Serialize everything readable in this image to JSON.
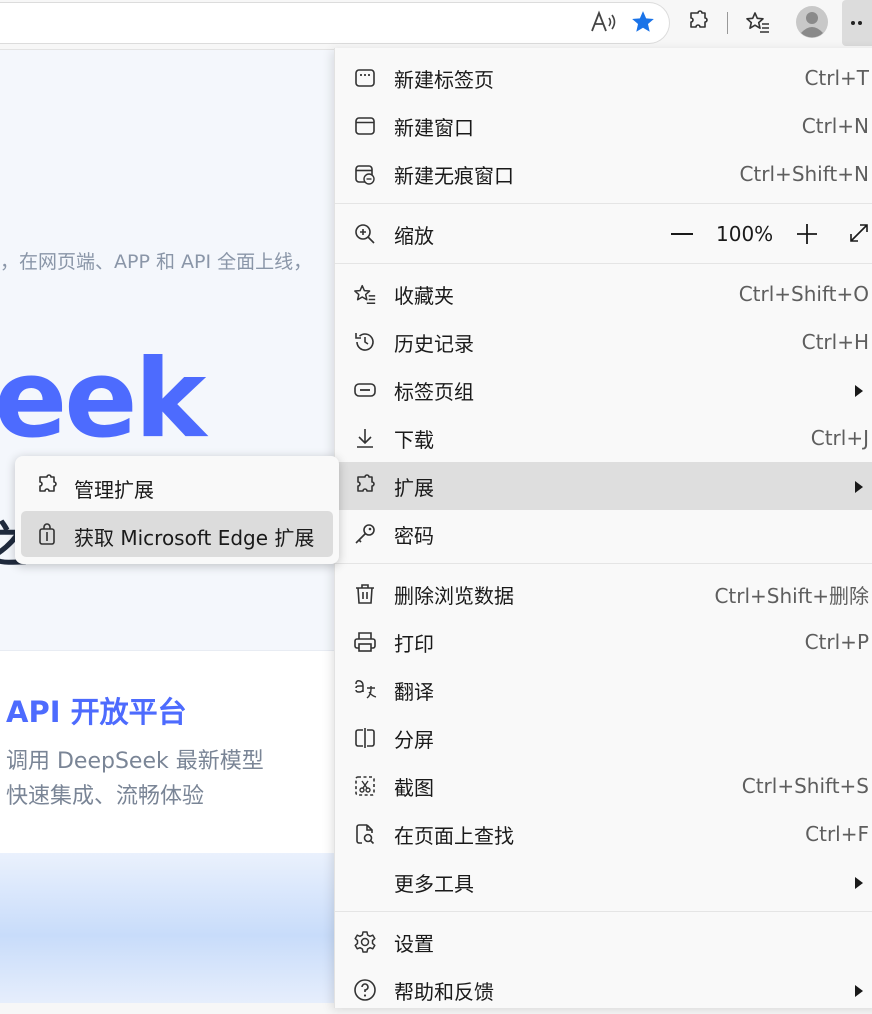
{
  "toolbar": {
    "icons": [
      "read-aloud-icon",
      "favorite-star-icon",
      "extensions-icon",
      "favorites-icon",
      "profile-icon",
      "more-icon"
    ],
    "accent": "#1a73e8"
  },
  "page": {
    "tagline": "，在网页端、APP 和 API 全面上线，",
    "brand": "eek",
    "brand_partial": "之",
    "card": {
      "title": "API 开放平台",
      "line1": "调用 DeepSeek 最新模型",
      "line2": "快速集成、流畅体验"
    },
    "brand_color": "#4d6bfe"
  },
  "menu": {
    "new_tab": {
      "label": "新建标签页",
      "shortcut": "Ctrl+T"
    },
    "new_window": {
      "label": "新建窗口",
      "shortcut": "Ctrl+N"
    },
    "new_inprivate": {
      "label": "新建无痕窗口",
      "shortcut": "Ctrl+Shift+N"
    },
    "zoom": {
      "label": "缩放",
      "value": "100%"
    },
    "favorites": {
      "label": "收藏夹",
      "shortcut": "Ctrl+Shift+O"
    },
    "history": {
      "label": "历史记录",
      "shortcut": "Ctrl+H"
    },
    "tab_groups": {
      "label": "标签页组"
    },
    "downloads": {
      "label": "下载",
      "shortcut": "Ctrl+J"
    },
    "extensions": {
      "label": "扩展"
    },
    "passwords": {
      "label": "密码"
    },
    "clear_data": {
      "label": "删除浏览数据",
      "shortcut": "Ctrl+Shift+删除"
    },
    "print": {
      "label": "打印",
      "shortcut": "Ctrl+P"
    },
    "translate": {
      "label": "翻译"
    },
    "split_screen": {
      "label": "分屏"
    },
    "screenshot": {
      "label": "截图",
      "shortcut": "Ctrl+Shift+S"
    },
    "find": {
      "label": "在页面上查找",
      "shortcut": "Ctrl+F"
    },
    "more_tools": {
      "label": "更多工具"
    },
    "settings": {
      "label": "设置"
    },
    "help": {
      "label": "帮助和反馈"
    }
  },
  "submenu": {
    "manage": {
      "label": "管理扩展"
    },
    "get": {
      "label": "获取 Microsoft Edge 扩展"
    }
  }
}
